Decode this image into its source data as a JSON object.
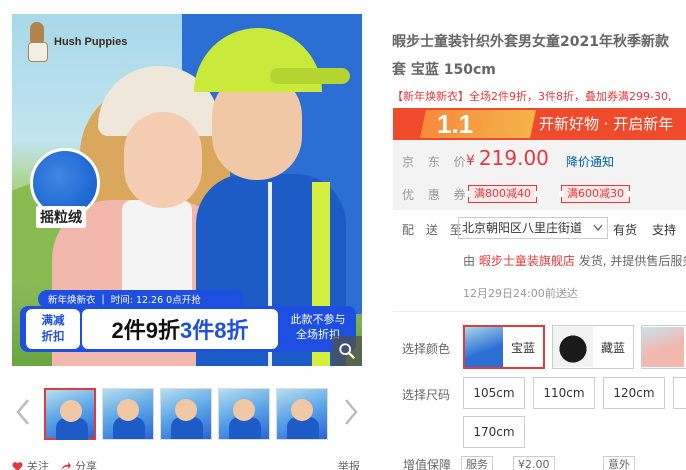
{
  "gallery": {
    "brand": "Hush Puppies",
    "fabric_label": "摇粒绒",
    "promo": {
      "top_label": "新年焕新衣",
      "time_label": "时间: 12.26 0点开抢",
      "left_text": "满减\n折扣",
      "offer_parts": [
        "2件",
        "9折",
        "3件",
        "8折"
      ],
      "right_text": "此款不参与\n全场折扣"
    },
    "thumbnail_count": 5,
    "follow_label": "关注",
    "share_label": "分享",
    "report_label": "举报"
  },
  "product": {
    "title_line1": "暇步士童装针织外套男女童2021年秋季新款",
    "title_line2": "套 宝蓝 150cm",
    "promo_tag": "【新年焕新衣】",
    "promo_text": "全场2件9折，3件8折，叠加券满299-30,",
    "sale_number": "1.1",
    "sale_slogan": "开新好物 · 开启新年",
    "price_label": "京 东 价",
    "price_currency": "¥",
    "price_value": "219.00",
    "notify_label": "降价通知",
    "coupon_label": "优 惠 券",
    "coupons": [
      "满800减40",
      "满600减30"
    ],
    "ship_label": "配 送 至",
    "address": "北京朝阳区八里庄街道",
    "stock_status": "有货",
    "support_label": "支持",
    "shop_prefix": "由",
    "shop_name": "暇步士童装旗舰店",
    "shop_suffix": "发货, 并提供售后服务",
    "delivery_note": "12月29日24:00前送达",
    "color_label": "选择颜色",
    "colors": [
      {
        "name": "宝蓝",
        "swatch": "sw-blue",
        "selected": true
      },
      {
        "name": "藏蓝",
        "swatch": "sw-navy",
        "selected": false
      },
      {
        "name": "",
        "swatch": "sw-pink",
        "selected": false
      }
    ],
    "size_label": "选择尺码",
    "sizes": [
      "105cm",
      "110cm",
      "120cm",
      "",
      "170cm"
    ],
    "service_label": "增值保障",
    "service_options": [
      "服务",
      "¥2.00",
      "意外"
    ]
  },
  "colors_theme": {
    "accent": "#e4393c",
    "link": "#005ea7",
    "promo_blue": "#1f4fe0",
    "sale_red": "#f04a2c"
  }
}
